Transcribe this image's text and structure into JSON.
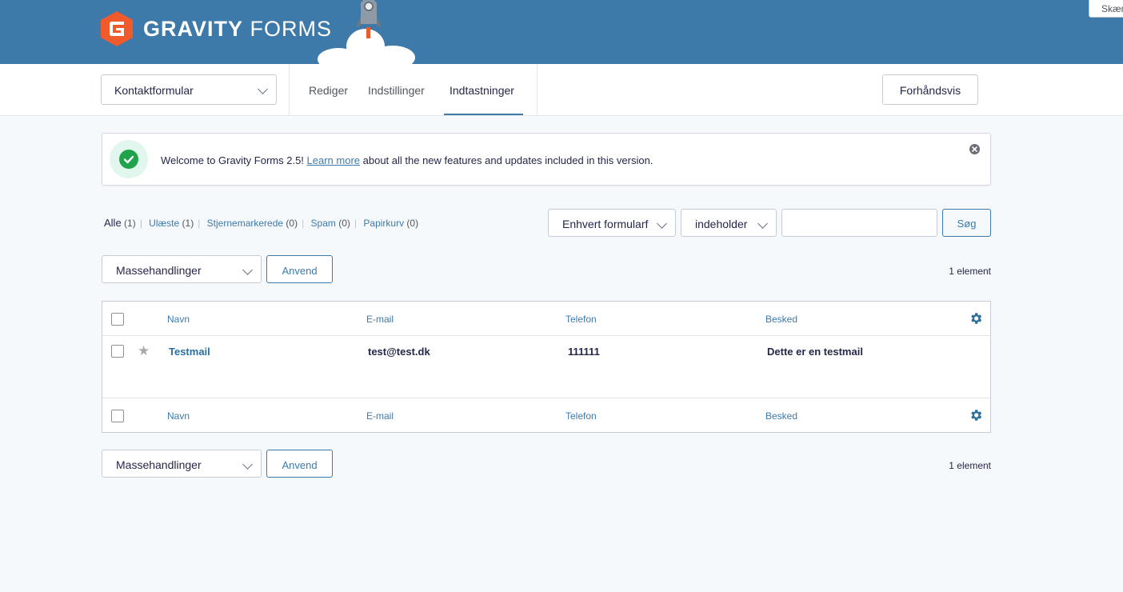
{
  "header": {
    "logo_bold": "GRAVITY",
    "logo_light": "FORMS",
    "screen_options_label": "Skærm"
  },
  "toolbar": {
    "form_selector_value": "Kontaktformular",
    "tabs": [
      {
        "label": "Rediger",
        "active": false
      },
      {
        "label": "Indstillinger",
        "active": false
      },
      {
        "label": "Indtastninger",
        "active": true
      }
    ],
    "preview_label": "Forhåndsvis"
  },
  "notice": {
    "text_before": "Welcome to Gravity Forms 2.5! ",
    "link_text": "Learn more",
    "text_after": " about all the new features and updates included in this version."
  },
  "filters": {
    "items": [
      {
        "label": "Alle",
        "count": "(1)",
        "current": true
      },
      {
        "label": "Ulæste",
        "count": "(1)",
        "current": false
      },
      {
        "label": "Stjernemarkerede",
        "count": "(0)",
        "current": false
      },
      {
        "label": "Spam",
        "count": "(0)",
        "current": false
      },
      {
        "label": "Papirkurv",
        "count": "(0)",
        "current": false
      }
    ]
  },
  "search": {
    "field_select_value": "Enhvert formularfelt",
    "operator_select_value": "indeholder",
    "input_value": "",
    "button_label": "Søg"
  },
  "bulk": {
    "select_value": "Massehandlinger",
    "apply_label": "Anvend",
    "count_text": "1 element"
  },
  "table": {
    "columns": [
      "Navn",
      "E-mail",
      "Telefon",
      "Besked"
    ],
    "rows": [
      {
        "name": "Testmail",
        "email": "test@test.dk",
        "phone": "111111",
        "message": "Dette er en testmail",
        "starred": false
      }
    ]
  },
  "colors": {
    "brand_blue": "#3e7aa9",
    "logo_orange": "#f15a2b",
    "success_green": "#1fa44c"
  }
}
